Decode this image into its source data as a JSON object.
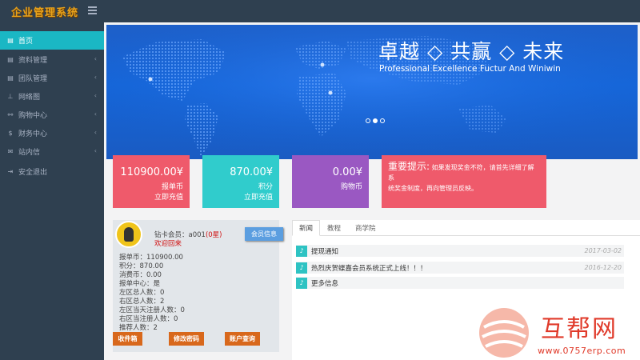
{
  "header": {
    "logo_text": "企业管理系统"
  },
  "sidebar": {
    "items": [
      {
        "label": "首页",
        "icon": "home-icon",
        "active": true
      },
      {
        "label": "资料管理",
        "icon": "doc-icon",
        "chevron": true
      },
      {
        "label": "团队管理",
        "icon": "team-icon",
        "chevron": true
      },
      {
        "label": "网络图",
        "icon": "sitemap-icon",
        "chevron": true
      },
      {
        "label": "购物中心",
        "icon": "cart-icon",
        "chevron": true
      },
      {
        "label": "财务中心",
        "icon": "dollar-icon",
        "chevron": true
      },
      {
        "label": "站内信",
        "icon": "mail-icon",
        "chevron": true
      },
      {
        "label": "安全退出",
        "icon": "signout-icon"
      }
    ]
  },
  "banner": {
    "title": "卓越 ◇ 共赢 ◇ 未来",
    "subtitle": "Professional Excellence Fuctur And Winiwin",
    "active_slide": 2,
    "slides": 3
  },
  "cards": {
    "c1": {
      "amount": "110900.00¥",
      "line1": "报单币",
      "line2": "立即充值",
      "color": "#ef5a6b"
    },
    "c2": {
      "amount": "870.00¥",
      "line1": "积分",
      "line2": "立即充值",
      "color": "#30cccc"
    },
    "c3": {
      "amount": "0.00¥",
      "line1": "购物币",
      "color": "#9a58c2"
    },
    "c4": {
      "title": "重要提示:",
      "text_a": "如果发现奖金不符，请首先详细了解系",
      "text_b": "统奖金制度，再向管理员反映。",
      "color": "#ef5a6b"
    }
  },
  "user": {
    "name_label": "钻卡会员：a001",
    "name_extra": "(0星)",
    "welcome": "欢迎回来",
    "info_button": "会员信息",
    "stats": [
      "报单币：110900.00",
      "积分：870.00",
      "消费币：0.00",
      "报单中心：是",
      "左区总人数：0",
      "右区总人数：2",
      "左区当天注册人数：0",
      "右区当注册人数：0",
      "推荐人数：2"
    ],
    "buttons": [
      "收件箱",
      "修改密码",
      "账户查询"
    ],
    "button_color": "#d8681c"
  },
  "news": {
    "tabs": [
      "新闻",
      "教程",
      "商学院"
    ],
    "items": [
      {
        "text": "提现通知",
        "date": "2017-03-02"
      },
      {
        "text": "热烈庆贺蝶嘉会员系统正式上线！！！",
        "date": "2016-12-20"
      },
      {
        "text": "更多信息",
        "date": ""
      }
    ]
  },
  "watermark": {
    "text_cn": "互帮网",
    "url": "www.0757erp.com"
  }
}
